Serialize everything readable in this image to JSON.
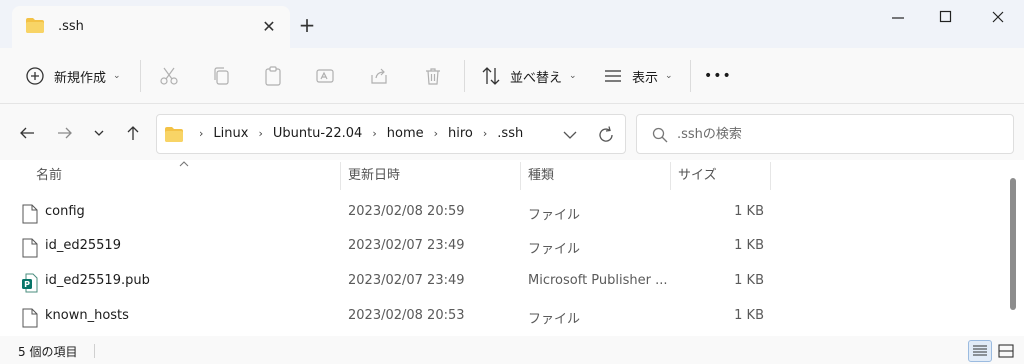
{
  "tab": {
    "title": ".ssh",
    "close_glyph": "✕",
    "new_tab_glyph": "+"
  },
  "window": {
    "minimize_glyph": "—",
    "maximize_glyph": "☐",
    "close_glyph": "✕"
  },
  "toolbar": {
    "new_label": "新規作成",
    "sort_label": "並べ替え",
    "view_label": "表示",
    "more_glyph": "•••"
  },
  "address": {
    "crumbs": [
      "Linux",
      "Ubuntu-22.04",
      "home",
      "hiro",
      ".ssh"
    ]
  },
  "search": {
    "placeholder": ".sshの検索"
  },
  "columns": {
    "name": "名前",
    "modified": "更新日時",
    "type": "種類",
    "size": "サイズ"
  },
  "files": [
    {
      "name": "config",
      "modified": "2023/02/08 20:59",
      "type": "ファイル",
      "size": "1 KB",
      "icon": "file-icon"
    },
    {
      "name": "id_ed25519",
      "modified": "2023/02/07 23:49",
      "type": "ファイル",
      "size": "1 KB",
      "icon": "file-icon"
    },
    {
      "name": "id_ed25519.pub",
      "modified": "2023/02/07 23:49",
      "type": "Microsoft Publisher ...",
      "size": "1 KB",
      "icon": "publisher-file-icon"
    },
    {
      "name": "known_hosts",
      "modified": "2023/02/08 20:53",
      "type": "ファイル",
      "size": "1 KB",
      "icon": "file-icon"
    }
  ],
  "status": {
    "item_count": "5 個の項目"
  },
  "colors": {
    "folder": "#f3c246",
    "accent": "#0067c0",
    "publisher": "#077568"
  }
}
